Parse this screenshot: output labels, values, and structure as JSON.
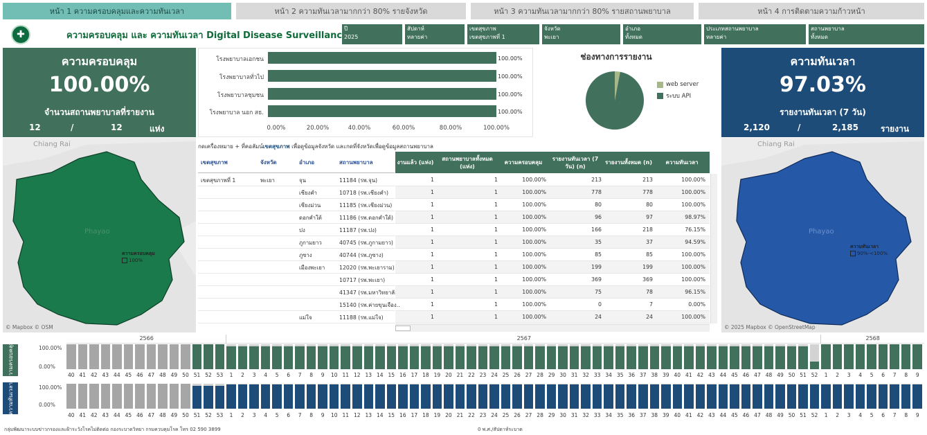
{
  "tabs": [
    {
      "label": "หน้า 1 ความครอบคลุมและความทันเวลา",
      "active": true
    },
    {
      "label": "หน้า 2 ความทันเวลามากกว่า 80% รายจังหวัด",
      "active": false
    },
    {
      "label": "หน้า 3 ความทันเวลามากกว่า 80% รายสถานพยาบาล",
      "active": false
    },
    {
      "label": "หน้า 4 การติดตามความก้าวหน้า",
      "active": false
    }
  ],
  "header": {
    "title": "ความครอบคลุม และ ความทันเวลา Digital Disease Surveillance"
  },
  "filters": [
    {
      "label": "ปี",
      "value": "2025"
    },
    {
      "label": "สัปดาห์",
      "value": "หลายค่า"
    },
    {
      "label": "เขตสุขภาพ",
      "value": "เขตสุขภาพที่ 1"
    },
    {
      "label": "จังหวัด",
      "value": "พะเยา"
    },
    {
      "label": "อำเภอ",
      "value": "ทั้งหมด"
    },
    {
      "label": "ประเภทสถานพยาบาล",
      "value": "หลายค่า"
    },
    {
      "label": "สถานพยาบาล",
      "value": "ทั้งหมด"
    }
  ],
  "coverage": {
    "title": "ความครอบคลุม",
    "value": "100.00%",
    "subtitle": "จำนวนสถานพยาบาลที่รายงาน",
    "reported": "12",
    "slash": "/",
    "total": "12",
    "unit": "แห่ง"
  },
  "timeliness": {
    "title": "ความทันเวลา",
    "value": "97.03%",
    "subtitle": "รายงานทันเวลา (7 วัน)",
    "ontime": "2,120",
    "slash": "/",
    "total": "2,185",
    "unit": "รายงาน"
  },
  "colors": {
    "green": "#41705d",
    "blue": "#1e4c79",
    "gray": "#a6a6a6",
    "tab_active": "#72bdb4",
    "legend_web": "#a6b888"
  },
  "chart_data": [
    {
      "type": "bar",
      "orientation": "horizontal",
      "categories": [
        "โรงพยาบาลเอกชน",
        "โรงพยาบาลทั่วไป",
        "โรงพยาบาลชุมชน",
        "โรงพยาบาล นอก สธ."
      ],
      "values": [
        100.0,
        100.0,
        100.0,
        100.0
      ],
      "value_labels": [
        "100.00%",
        "100.00%",
        "100.00%",
        "100.00%"
      ],
      "xlim": [
        0,
        100
      ],
      "x_ticks": [
        "0.00%",
        "20.00%",
        "40.00%",
        "60.00%",
        "80.00%",
        "100.00%"
      ]
    },
    {
      "type": "pie",
      "title": "ช่องทางการรายงาน",
      "categories": [
        "web server",
        "ระบบ API"
      ],
      "values": [
        3,
        97
      ],
      "legend": "right"
    }
  ],
  "maps": {
    "left": {
      "city_top": "Chiang Rai",
      "city_center": "Phayao",
      "legend_title": "ความครอบคลุม",
      "legend_item": "100%",
      "credit": "© Mapbox © OSM"
    },
    "right": {
      "city_top": "Chiang Rai",
      "city_center": "Phayao",
      "legend_title": "ความทันเวลา",
      "legend_item": "90%-<100%",
      "credit": "© 2025 Mapbox © OpenStreetMap"
    }
  },
  "table": {
    "note_pre": "กดเครื่องหมาย + ที่คอลัมน์",
    "note_bold": "เขตสุขภาพ",
    "note_post": " เพื่อดูข้อมูลจังหวัด และกดที่จังหวัดเพื่อดูข้อมูลสถานพยาบาล",
    "dim_headers": [
      "เขตสุขภาพ",
      "จังหวัด",
      "อำเภอ",
      "สถานพยาบาล"
    ],
    "measure_headers": [
      "งานแล้ว (แห่ง)",
      "สถานพยาบาลทั้งหมด (แห่ง)",
      "ความครอบคลุม",
      "รายงานทันเวลา (7 วัน) (n)",
      "รายงานทั้งหมด (n)",
      "ความทันเวลา"
    ],
    "rows": [
      {
        "region": "เขตสุขภาพที่ 1",
        "province": "พะเยา",
        "district": "จุน",
        "hospital": "11184 (รพ.จุน)",
        "reported": "1",
        "total_hosp": "1",
        "coverage": "100.00%",
        "ontime": "213",
        "total_rep": "213",
        "timeliness": "100.00%"
      },
      {
        "region": "",
        "province": "",
        "district": "เชียงคำ",
        "hospital": "10718 (รพ.เชียงคำ)",
        "reported": "1",
        "total_hosp": "1",
        "coverage": "100.00%",
        "ontime": "778",
        "total_rep": "778",
        "timeliness": "100.00%"
      },
      {
        "region": "",
        "province": "",
        "district": "เชียงม่วน",
        "hospital": "11185 (รพ.เชียงม่วน)",
        "reported": "1",
        "total_hosp": "1",
        "coverage": "100.00%",
        "ontime": "80",
        "total_rep": "80",
        "timeliness": "100.00%"
      },
      {
        "region": "",
        "province": "",
        "district": "ดอกคำใต้",
        "hospital": "11186 (รพ.ดอกคำใต้)",
        "reported": "1",
        "total_hosp": "1",
        "coverage": "100.00%",
        "ontime": "96",
        "total_rep": "97",
        "timeliness": "98.97%"
      },
      {
        "region": "",
        "province": "",
        "district": "ปง",
        "hospital": "11187 (รพ.ปง)",
        "reported": "1",
        "total_hosp": "1",
        "coverage": "100.00%",
        "ontime": "166",
        "total_rep": "218",
        "timeliness": "76.15%"
      },
      {
        "region": "",
        "province": "",
        "district": "ภูกามยาว",
        "hospital": "40745 (รพ.ภูกามยาว)",
        "reported": "1",
        "total_hosp": "1",
        "coverage": "100.00%",
        "ontime": "35",
        "total_rep": "37",
        "timeliness": "94.59%"
      },
      {
        "region": "",
        "province": "",
        "district": "ภูซาง",
        "hospital": "40744 (รพ.ภูซาง)",
        "reported": "1",
        "total_hosp": "1",
        "coverage": "100.00%",
        "ontime": "85",
        "total_rep": "85",
        "timeliness": "100.00%"
      },
      {
        "region": "",
        "province": "",
        "district": "เมืองพะเยา",
        "hospital": "12020 (รพ.พะเยาราม)",
        "reported": "1",
        "total_hosp": "1",
        "coverage": "100.00%",
        "ontime": "199",
        "total_rep": "199",
        "timeliness": "100.00%"
      },
      {
        "region": "",
        "province": "",
        "district": "",
        "hospital": "10717 (รพ.พะเยา)",
        "reported": "1",
        "total_hosp": "1",
        "coverage": "100.00%",
        "ontime": "369",
        "total_rep": "369",
        "timeliness": "100.00%"
      },
      {
        "region": "",
        "province": "",
        "district": "",
        "hospital": "41347 (รพ.มหาวิทยาลัย..",
        "reported": "1",
        "total_hosp": "1",
        "coverage": "100.00%",
        "ontime": "75",
        "total_rep": "78",
        "timeliness": "96.15%"
      },
      {
        "region": "",
        "province": "",
        "district": "",
        "hospital": "15140 (รพ.ค่ายขุนเจือง..",
        "reported": "1",
        "total_hosp": "1",
        "coverage": "100.00%",
        "ontime": "0",
        "total_rep": "7",
        "timeliness": "0.00%"
      },
      {
        "region": "",
        "province": "",
        "district": "แม่ใจ",
        "hospital": "11188 (รพ.แม่ใจ)",
        "reported": "1",
        "total_hosp": "1",
        "coverage": "100.00%",
        "ontime": "24",
        "total_rep": "24",
        "timeliness": "100.00%"
      }
    ]
  },
  "weekly": {
    "years": [
      {
        "label": "2566",
        "from_week_index": 0
      },
      {
        "label": "2567",
        "from_week_index": 14
      },
      {
        "label": "2568",
        "from_week_index": 66
      }
    ],
    "weeks": [
      "40",
      "41",
      "42",
      "43",
      "44",
      "45",
      "46",
      "47",
      "48",
      "49",
      "50",
      "51",
      "52",
      "53",
      "1",
      "2",
      "3",
      "4",
      "5",
      "6",
      "7",
      "8",
      "9",
      "10",
      "11",
      "12",
      "13",
      "14",
      "15",
      "16",
      "17",
      "18",
      "19",
      "20",
      "21",
      "22",
      "23",
      "24",
      "25",
      "26",
      "27",
      "28",
      "29",
      "30",
      "31",
      "32",
      "33",
      "34",
      "35",
      "36",
      "37",
      "38",
      "39",
      "40",
      "41",
      "42",
      "43",
      "44",
      "45",
      "46",
      "47",
      "48",
      "49",
      "50",
      "51",
      "52",
      "1",
      "2",
      "3",
      "4",
      "5",
      "6",
      "7",
      "8",
      "9"
    ],
    "gray_count": 11,
    "coverage_row": {
      "label": "ความครอบคลุม",
      "tick_top": "100.00%",
      "tick_bottom": "0.00%",
      "values": [
        100,
        100,
        100,
        100,
        100,
        100,
        100,
        100,
        100,
        100,
        100,
        100,
        100,
        100,
        92,
        92,
        92,
        92,
        92,
        92,
        92,
        92,
        92,
        92,
        92,
        92,
        92,
        92,
        92,
        92,
        92,
        92,
        92,
        92,
        92,
        92,
        92,
        92,
        92,
        92,
        92,
        92,
        92,
        92,
        92,
        92,
        92,
        92,
        92,
        92,
        92,
        92,
        92,
        92,
        92,
        92,
        92,
        92,
        92,
        92,
        92,
        92,
        92,
        92,
        92,
        30,
        100,
        100,
        100,
        100,
        100,
        100,
        100,
        100,
        100
      ]
    },
    "timeliness_row": {
      "label": "ความทันเวลา",
      "tick_top": "100.00%",
      "tick_bottom": "0.00%",
      "values": [
        100,
        100,
        100,
        100,
        100,
        100,
        100,
        100,
        100,
        100,
        100,
        92,
        92,
        92,
        96,
        96,
        96,
        96,
        96,
        96,
        96,
        96,
        96,
        96,
        96,
        96,
        96,
        96,
        96,
        96,
        96,
        96,
        96,
        96,
        96,
        96,
        96,
        96,
        96,
        96,
        96,
        96,
        96,
        96,
        96,
        96,
        96,
        96,
        96,
        96,
        96,
        96,
        96,
        96,
        96,
        96,
        96,
        96,
        96,
        96,
        96,
        96,
        96,
        96,
        96,
        96,
        96,
        96,
        96,
        96,
        96,
        96,
        96,
        96,
        96
      ]
    }
  },
  "footer": {
    "left": "กลุ่มพัฒนาระบบข่าวกรองและฝ้าระวังโรคไม่ติดต่อ กองระบาดวิทยา กรมควบคุมโรค โทร 02 590 3899",
    "center": "0 พ.ศ./สัปดาห์ระบาด"
  }
}
